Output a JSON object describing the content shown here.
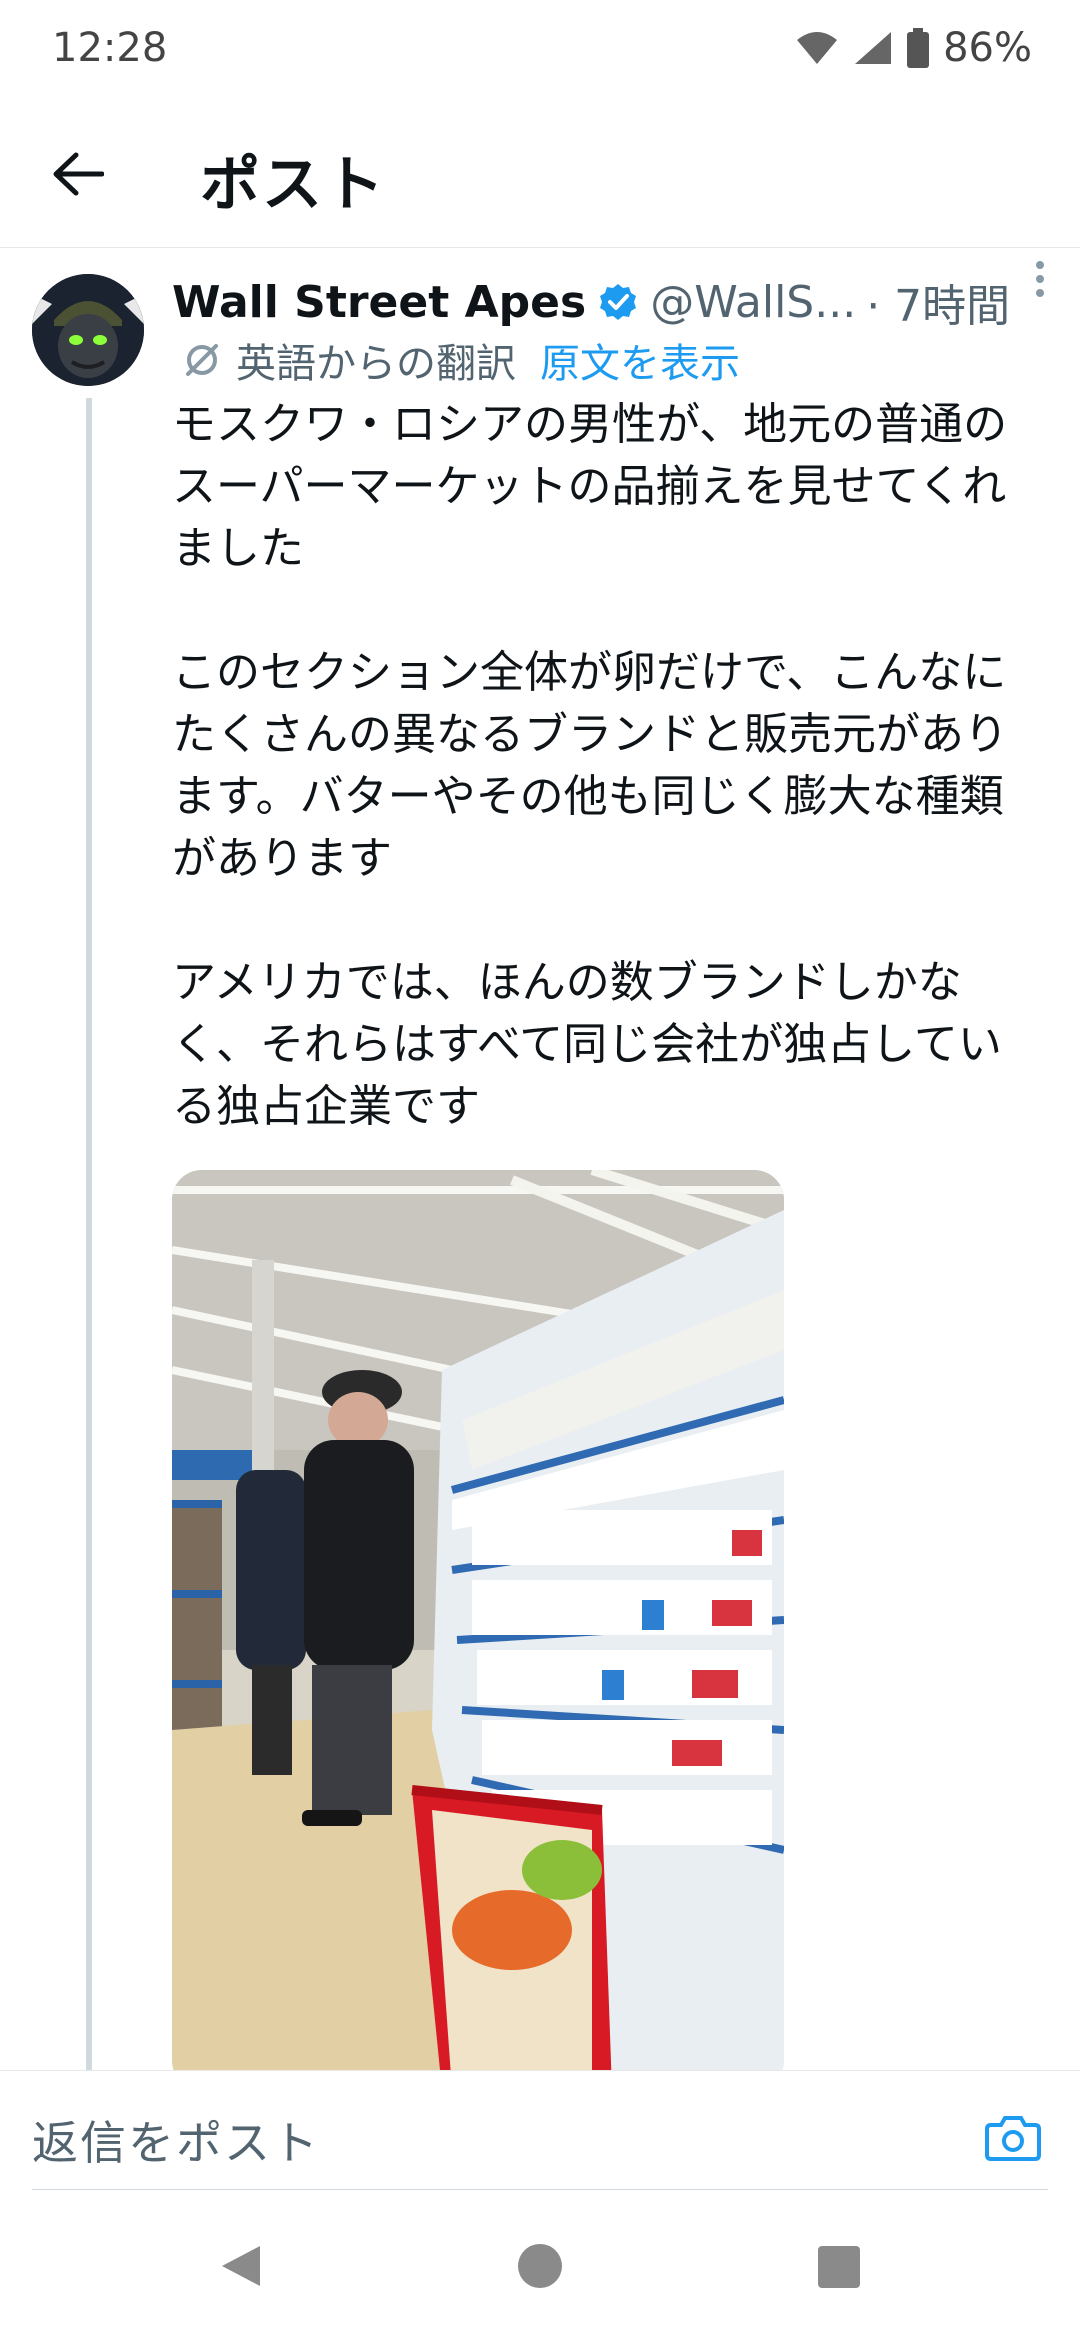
{
  "status_bar": {
    "time": "12:28",
    "battery": "86%",
    "icons": [
      "wifi-icon",
      "signal-icon",
      "battery-icon"
    ]
  },
  "header": {
    "title": "ポスト",
    "back_icon": "arrow-left-icon"
  },
  "tweet": {
    "display_name": "Wall Street Apes",
    "handle": "@WallS...",
    "time": "· 7時間",
    "translate_label": "英語からの翻訳",
    "show_original": "原文を表示",
    "text": "モスクワ・ロシアの男性が、地元の普通のスーパーマーケットの品揃えを見せてくれました\n\nこのセクション全体が卵だけで、こんなにたくさんの異なるブランドと販売元があります。バターやその他も同じく膨大な種類があります\n\nアメリカでは、ほんの数ブランドしかなく、それらはすべて同じ会社が独占している独占企業です"
  },
  "reply_bar": {
    "placeholder": "返信をポスト"
  },
  "colors": {
    "accent": "#1d9bf0",
    "text_primary": "#0f1419",
    "text_secondary": "#536471",
    "thread_line": "#cfd9de"
  }
}
